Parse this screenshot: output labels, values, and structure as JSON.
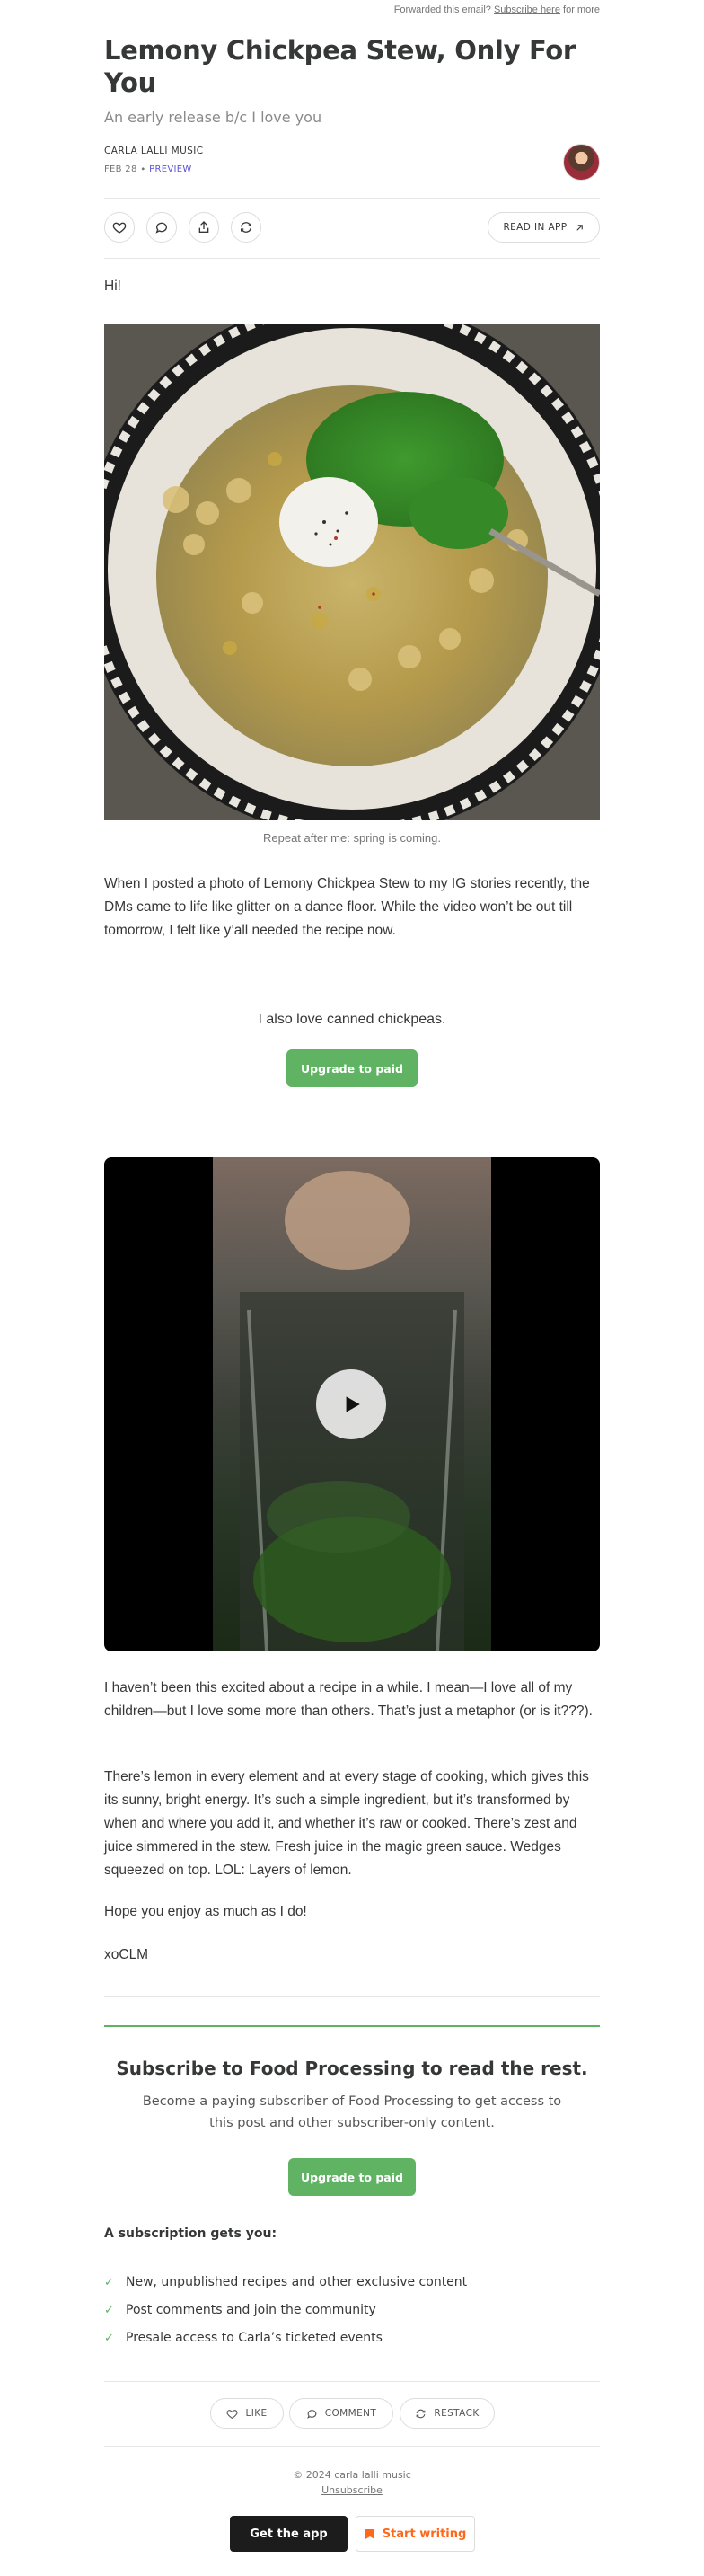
{
  "header": {
    "forward_text": "Forwarded this email?",
    "subscribe_link": "Subscribe here",
    "forward_suffix": "for more"
  },
  "post": {
    "title": "Lemony Chickpea Stew, Only For You",
    "subtitle": "An early release b/c I love you",
    "author": "CARLA LALLI MUSIC",
    "date": "FEB 28",
    "date_sep": " ∙ ",
    "status": "PREVIEW"
  },
  "actions": {
    "read_in_app": "READ IN APP"
  },
  "content": {
    "greeting": "Hi!",
    "photo_caption": "Repeat after me: spring is coming.",
    "paragraph_1": "When I posted a photo of Lemony Chickpea Stew to my IG stories recently, the DMs came to life like glitter on a dance floor. While the video won’t be out till tomorrow, I felt like y’all needed the recipe now.",
    "paywall_line": "I also love canned chickpeas.",
    "upgrade_label": "Upgrade to paid",
    "paragraph_2": "I haven’t been this excited about a recipe in a while. I mean—I love all of my children—but I love some more than others. That’s just a metaphor (or is it???).",
    "paragraph_3": "There’s lemon in every element and at every stage of cooking, which gives this its sunny, bright energy. It’s such a simple ingredient, but it’s transformed by when and where you add it, and whether it’s raw or cooked. There’s zest and juice simmered in the stew. Fresh juice in the magic green sauce. Wedges squeezed on top. LOL: Layers of lemon.",
    "paragraph_4": "Hope you enjoy as much as I do!",
    "signoff": "xoCLM"
  },
  "subscribe": {
    "title": "Subscribe to Food Processing to read the rest.",
    "description": "Become a paying subscriber of Food Processing to get access to this post and other subscriber-only content.",
    "button": "Upgrade to paid",
    "gets_title": "A subscription gets you:",
    "benefits": [
      "New, unpublished recipes and other exclusive content",
      "Post comments and join the community",
      "Presale access to Carla’s ticketed events"
    ]
  },
  "footer_actions": {
    "like": "LIKE",
    "comment": "COMMENT",
    "restack": "RESTACK"
  },
  "footer": {
    "copyright": "© 2024 carla lalli music",
    "unsubscribe": "Unsubscribe",
    "get_app": "Get the app",
    "start_writing": "Start writing"
  },
  "colors": {
    "accent_green": "#5fb362",
    "preview_purple": "#5b51d8",
    "start_writing_orange": "#ff6719"
  }
}
